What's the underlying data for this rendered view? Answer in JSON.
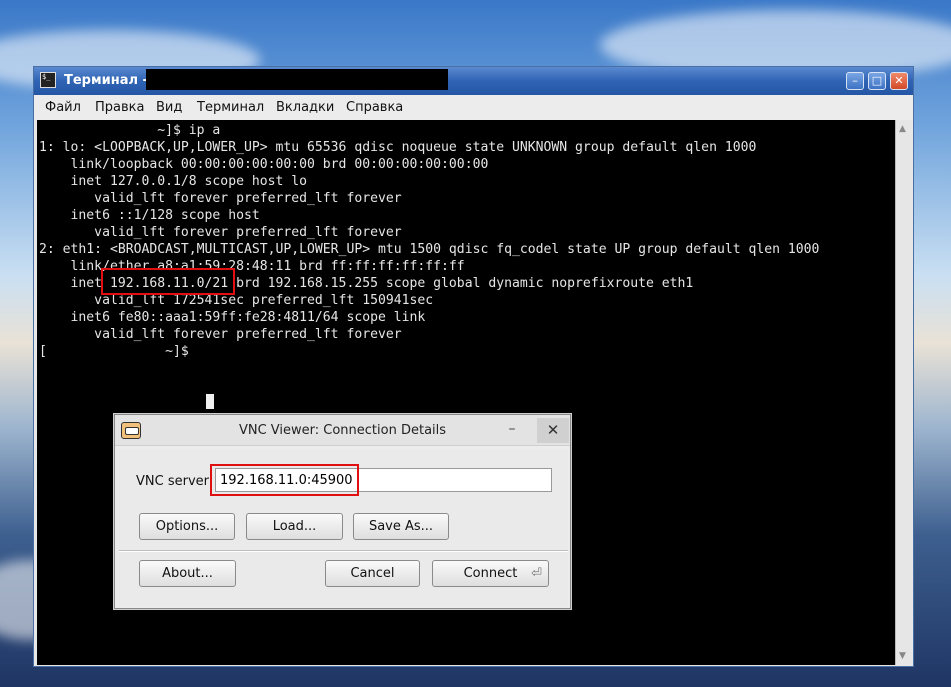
{
  "terminal": {
    "title": "Терминал - ",
    "menu": [
      "Файл",
      "Правка",
      "Вид",
      "Терминал",
      "Вкладки",
      "Справка"
    ],
    "lines": [
      "               ~]$ ip a",
      "1: lo: <LOOPBACK,UP,LOWER_UP> mtu 65536 qdisc noqueue state UNKNOWN group default qlen 1000",
      "    link/loopback 00:00:00:00:00:00 brd 00:00:00:00:00:00",
      "    inet 127.0.0.1/8 scope host lo",
      "       valid_lft forever preferred_lft forever",
      "    inet6 ::1/128 scope host",
      "       valid_lft forever preferred_lft forever",
      "2: eth1: <BROADCAST,MULTICAST,UP,LOWER_UP> mtu 1500 qdisc fq_codel state UP group default qlen 1000",
      "    link/ether a8:a1:59:28:48:11 brd ff:ff:ff:ff:ff:ff",
      "    inet 192.168.11.0/21 brd 192.168.15.255 scope global dynamic noprefixroute eth1",
      "       valid_lft 172541sec preferred_lft 150941sec",
      "    inet6 fe80::aaa1:59ff:fe28:4811/64 scope link",
      "       valid_lft forever preferred_lft forever",
      "[               ~]$ "
    ],
    "window_buttons": {
      "minimize": "–",
      "maximize": "□",
      "close": "✕"
    }
  },
  "vnc": {
    "title": "VNC Viewer: Connection Details",
    "minimize": "–",
    "close": "✕",
    "server_label": "VNC server:",
    "server_value": "192.168.11.0:45900",
    "buttons": {
      "options": "Options...",
      "load": "Load...",
      "save_as": "Save As...",
      "about": "About...",
      "cancel": "Cancel",
      "connect": "Connect"
    }
  }
}
